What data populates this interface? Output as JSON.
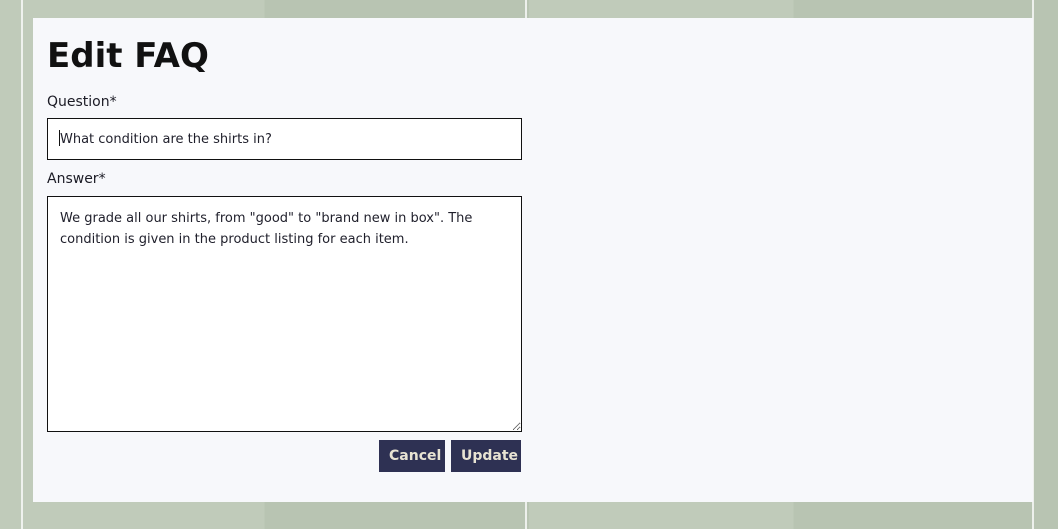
{
  "page": {
    "title": "Edit FAQ"
  },
  "form": {
    "question": {
      "label": "Question*",
      "value": "What condition are the shirts in?"
    },
    "answer": {
      "label": "Answer*",
      "value": "We grade all our shirts, from \"good\" to \"brand new in box\". The condition is given in the product listing for each item."
    },
    "buttons": {
      "cancel": "Cancel",
      "update": "Update"
    }
  },
  "colors": {
    "background": "#bcc8b6",
    "card": "#f7f8fb",
    "button": "#2e3153",
    "button_text": "#e8e3d3",
    "border": "#111111"
  },
  "icons": {
    "textarea_resize_handle": "resize-grip-icon"
  }
}
